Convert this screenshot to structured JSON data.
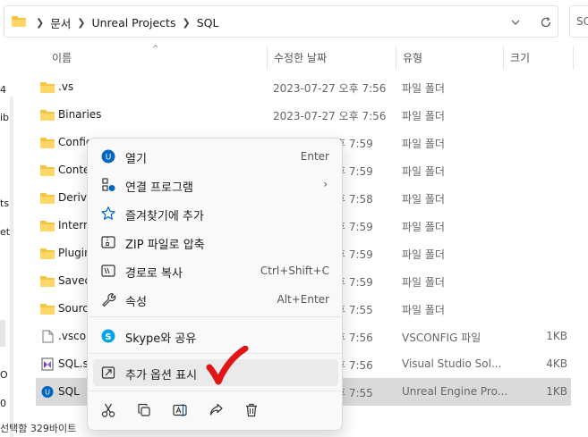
{
  "address": {
    "crumbs": [
      "문서",
      "Unreal Projects",
      "SQL"
    ],
    "search_fragment": "SC"
  },
  "nav": {
    "fragments": [
      "4",
      "ib",
      "ts",
      "et",
      "O",
      "0",
      "s"
    ]
  },
  "columns": {
    "name": "이름",
    "date": "수정한 날짜",
    "type": "유형",
    "size": "크기"
  },
  "files": [
    {
      "name": ".vs",
      "date": "2023-07-27 오후 7:56",
      "type": "파일 폴더",
      "size": "",
      "icon": "folder-icon"
    },
    {
      "name": "Binaries",
      "date": "2023-07-27 오후 7:56",
      "type": "파일 폴더",
      "size": "",
      "icon": "folder-icon"
    },
    {
      "name": "Config",
      "date": "후 7:59",
      "type": "파일 폴더",
      "size": "",
      "icon": "folder-icon"
    },
    {
      "name": "Conte",
      "date": "후 7:59",
      "type": "파일 폴더",
      "size": "",
      "icon": "folder-icon"
    },
    {
      "name": "Derive",
      "date": "후 7:58",
      "type": "파일 폴더",
      "size": "",
      "icon": "folder-icon"
    },
    {
      "name": "Interm",
      "date": "후 7:59",
      "type": "파일 폴더",
      "size": "",
      "icon": "folder-icon"
    },
    {
      "name": "Plugin",
      "date": "후 7:59",
      "type": "파일 폴더",
      "size": "",
      "icon": "folder-icon"
    },
    {
      "name": "Saved",
      "date": "후 7:59",
      "type": "파일 폴더",
      "size": "",
      "icon": "folder-icon"
    },
    {
      "name": "Sourc",
      "date": "후 7:55",
      "type": "파일 폴더",
      "size": "",
      "icon": "folder-icon"
    },
    {
      "name": ".vscor",
      "date": "후 7:56",
      "type": "VSCONFIG 파일",
      "size": "1KB",
      "icon": "file-icon"
    },
    {
      "name": "SQL.s",
      "date": "후 7:56",
      "type": "Visual Studio Sol...",
      "size": "4KB",
      "icon": "visual-studio-icon"
    },
    {
      "name": "SQL",
      "date": "후 7:55",
      "type": "Unreal Engine Pro...",
      "size": "1KB",
      "icon": "unreal-engine-icon"
    }
  ],
  "status_text": "선택함 329바이트",
  "context_menu": {
    "items": [
      {
        "label": "열기",
        "shortcut": "Enter",
        "icon": "unreal-engine-icon"
      },
      {
        "label": "연결 프로그램",
        "shortcut": "",
        "icon": "open-with-icon",
        "submenu": "›"
      },
      {
        "label": "즐겨찾기에 추가",
        "shortcut": "",
        "icon": "star-icon"
      },
      {
        "label": "ZIP 파일로 압축",
        "shortcut": "",
        "icon": "zip-icon"
      },
      {
        "label": "경로로 복사",
        "shortcut": "Ctrl+Shift+C",
        "icon": "copy-path-icon"
      },
      {
        "label": "속성",
        "shortcut": "Alt+Enter",
        "icon": "wrench-icon"
      },
      {
        "label": "Skype와 공유",
        "shortcut": "",
        "icon": "skype-icon"
      },
      {
        "label": "추가 옵션 표시",
        "shortcut": "",
        "icon": "show-more-options-icon"
      }
    ],
    "actions": [
      "cut-icon",
      "copy-icon",
      "rename-icon",
      "share-icon",
      "delete-icon"
    ]
  },
  "colors": {
    "folder": "#F5C542",
    "accent": "#0067C0",
    "checkmark": "#E01515",
    "selected_row": "#DADADA"
  }
}
